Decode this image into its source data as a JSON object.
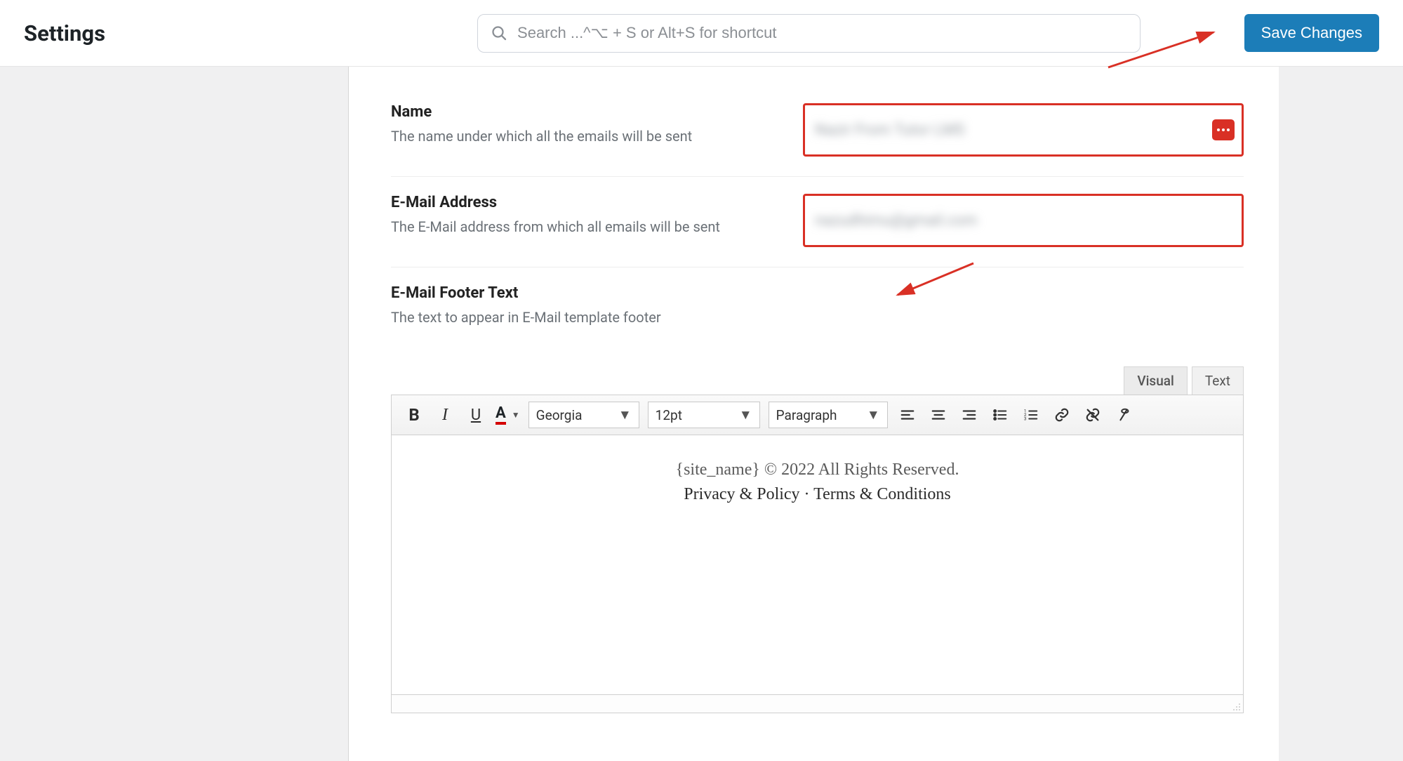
{
  "header": {
    "title": "Settings",
    "search_placeholder": "Search ...^⌥ + S or Alt+S for shortcut",
    "save_label": "Save Changes"
  },
  "fields": {
    "name": {
      "label": "Name",
      "sub": "The name under which all the emails will be sent",
      "value": "Nazir From Tutor LMS"
    },
    "email": {
      "label": "E-Mail Address",
      "sub": "The E-Mail address from which all emails will be sent",
      "value": "nazudhimu@gmail.com"
    },
    "footer": {
      "label": "E-Mail Footer Text",
      "sub": "The text to appear in E-Mail template footer"
    }
  },
  "editor": {
    "tabs": {
      "visual": "Visual",
      "text": "Text",
      "active": "visual"
    },
    "toolbar": {
      "font": "Georgia",
      "size": "12pt",
      "block": "Paragraph"
    },
    "content": {
      "line1": "{site_name} © 2022 All Rights Reserved.",
      "line2": "Privacy & Policy · Terms & Conditions"
    }
  },
  "colors": {
    "highlight": "#d93025",
    "primary": "#1c7db8"
  }
}
